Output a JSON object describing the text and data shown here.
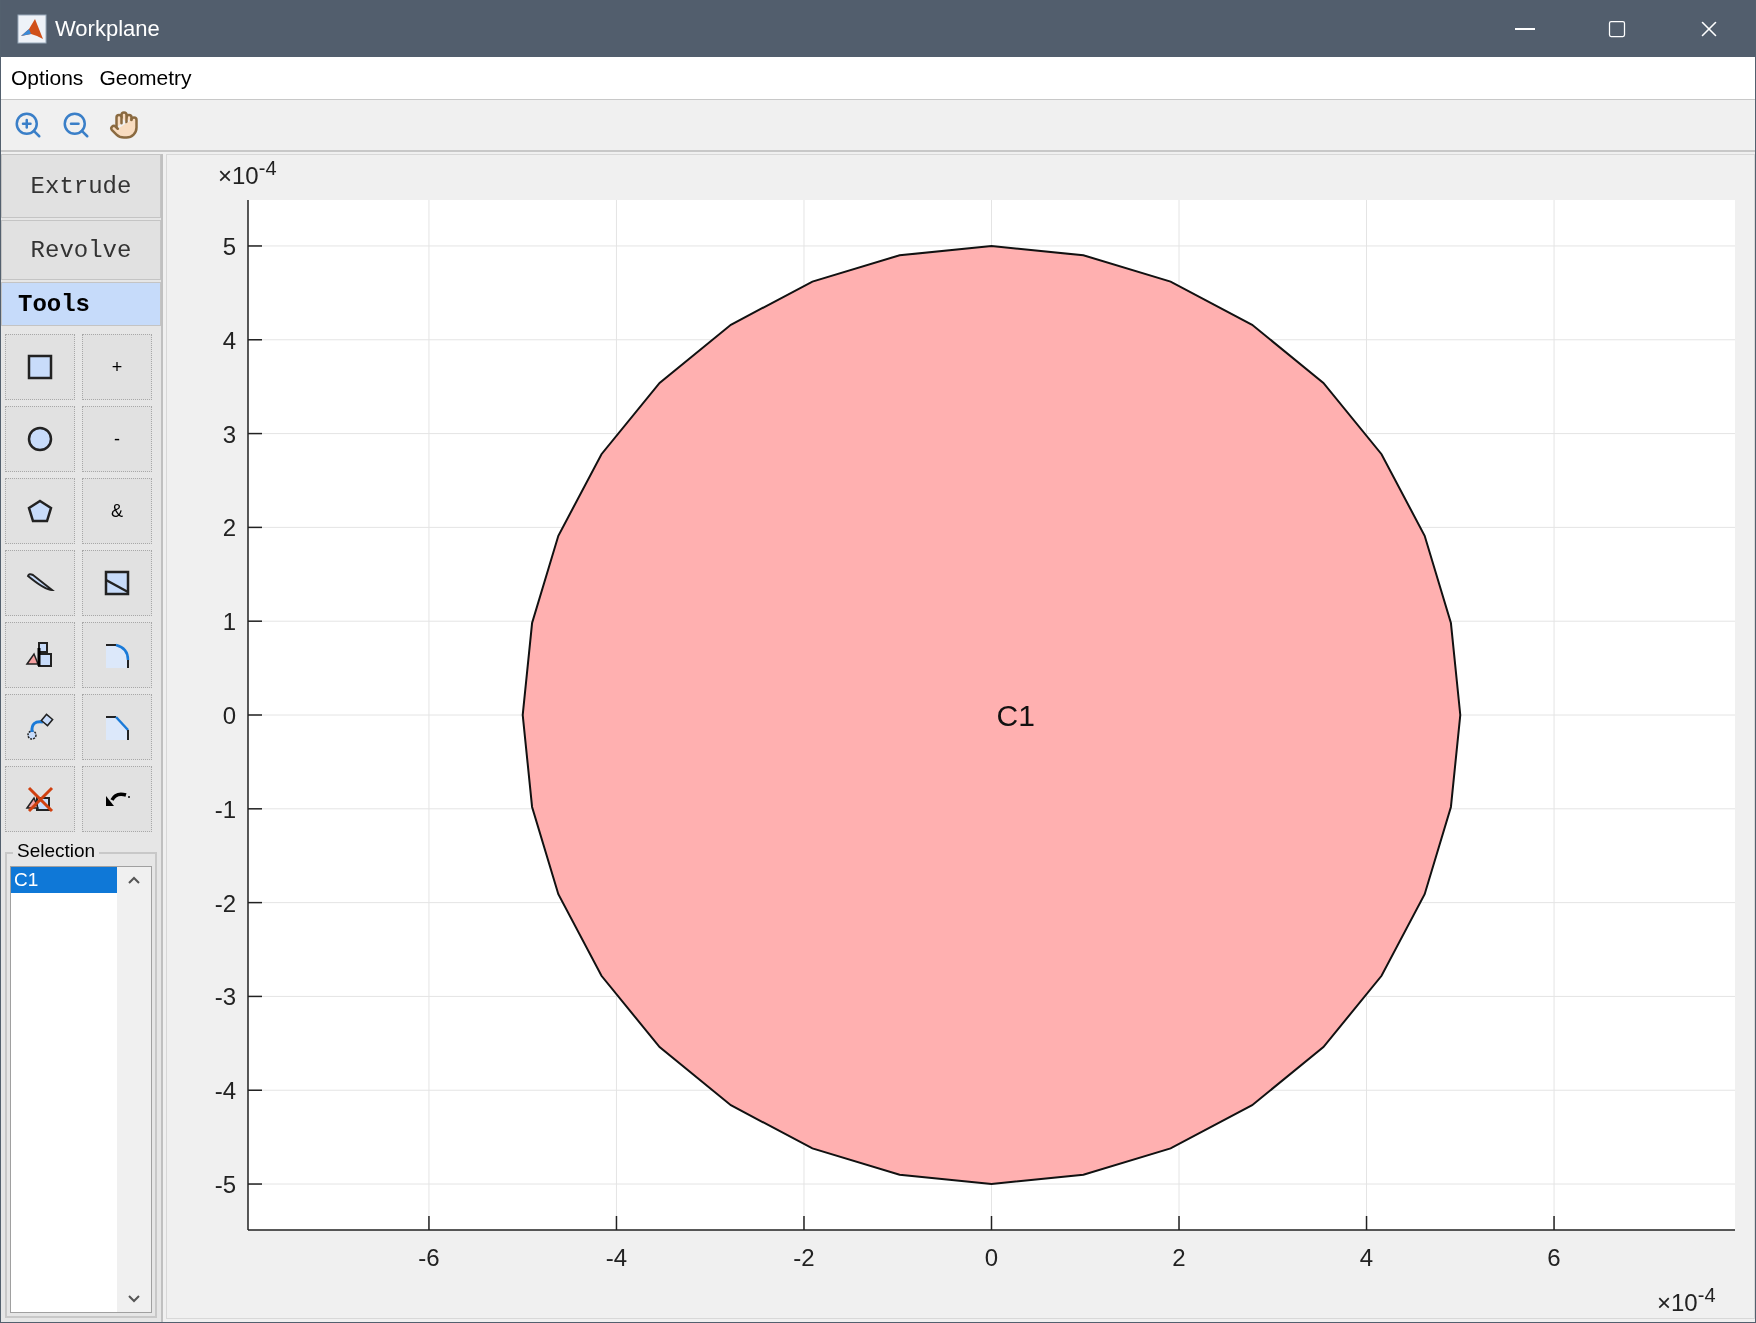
{
  "window": {
    "title": "Workplane"
  },
  "menu": [
    "Options",
    "Geometry"
  ],
  "toolbar": [
    {
      "kind": "zoom-in"
    },
    {
      "kind": "zoom-out"
    },
    {
      "kind": "pan"
    }
  ],
  "modes": [
    {
      "label": "Extrude",
      "selected": false
    },
    {
      "label": "Revolve",
      "selected": false
    },
    {
      "label": "Tools",
      "selected": true
    }
  ],
  "tools": [
    {
      "kind": "rectangle"
    },
    {
      "kind": "text",
      "label": "+"
    },
    {
      "kind": "circle"
    },
    {
      "kind": "text",
      "label": "-"
    },
    {
      "kind": "polygon"
    },
    {
      "kind": "text",
      "label": "&"
    },
    {
      "kind": "blade"
    },
    {
      "kind": "cut"
    },
    {
      "kind": "objects"
    },
    {
      "kind": "fillet"
    },
    {
      "kind": "move"
    },
    {
      "kind": "chamfer"
    },
    {
      "kind": "delete"
    },
    {
      "kind": "undo"
    }
  ],
  "selection": {
    "title": "Selection",
    "items": [
      {
        "label": "C1",
        "selected": true
      }
    ]
  },
  "plot": {
    "x_exponent": "×10$^{-4}$",
    "y_exponent": "×10$^{-4}$",
    "chart_data": {
      "type": "area",
      "x": [
        5,
        4.9,
        4.62,
        4.16,
        3.54,
        2.78,
        1.91,
        0.98,
        0,
        -0.98,
        -1.91,
        -2.78,
        -3.54,
        -4.16,
        -4.62,
        -4.9,
        -5,
        -4.9,
        -4.62,
        -4.16,
        -3.54,
        -2.78,
        -1.91,
        -0.98,
        0,
        0.98,
        1.91,
        2.78,
        3.54,
        4.16,
        4.62,
        4.9,
        5
      ],
      "series": [
        {
          "name": "C1",
          "color": "#ffb0b0",
          "values": [
            0,
            0.98,
            1.91,
            2.78,
            3.54,
            4.16,
            4.62,
            4.9,
            5,
            4.9,
            4.62,
            4.16,
            3.54,
            2.78,
            1.91,
            0.98,
            0,
            -0.98,
            -1.91,
            -2.78,
            -3.54,
            -4.16,
            -4.62,
            -4.9,
            -5,
            -4.9,
            -4.62,
            -4.16,
            -3.54,
            -2.78,
            -1.91,
            -0.98,
            0
          ]
        }
      ],
      "xlim": [
        -7.93,
        7.93
      ],
      "ylim": [
        -5.49,
        5.49
      ],
      "xticks": [
        -6,
        -4,
        -2,
        0,
        2,
        4,
        6
      ],
      "yticks": [
        -5,
        -4,
        -3,
        -2,
        -1,
        0,
        1,
        2,
        3,
        4,
        5
      ],
      "grid": true
    }
  }
}
